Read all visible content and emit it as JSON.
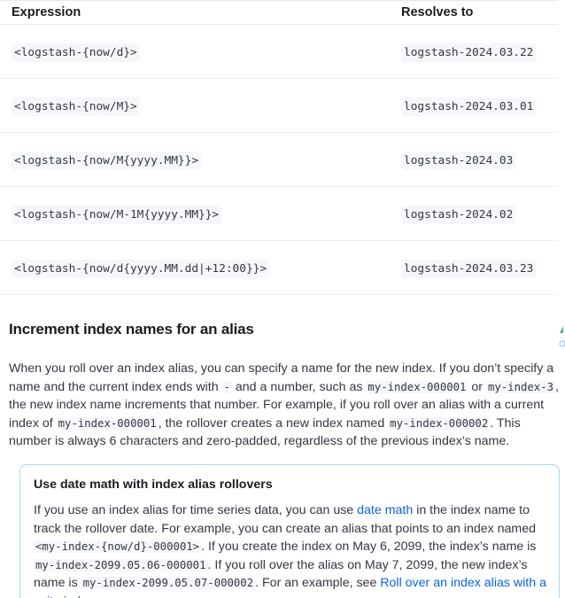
{
  "table": {
    "headers": {
      "expression": "Expression",
      "resolves_to": "Resolves to"
    },
    "rows": [
      {
        "expression": "<logstash-{now/d}>",
        "resolves_to": "logstash-2024.03.22"
      },
      {
        "expression": "<logstash-{now/M}>",
        "resolves_to": "logstash-2024.03.01"
      },
      {
        "expression": "<logstash-{now/M{yyyy.MM}}>",
        "resolves_to": "logstash-2024.03"
      },
      {
        "expression": "<logstash-{now/M-1M{yyyy.MM}}>",
        "resolves_to": "logstash-2024.02"
      },
      {
        "expression": "<logstash-{now/d{yyyy.MM.dd|+12:00}}>",
        "resolves_to": "logstash-2024.03.23"
      }
    ]
  },
  "section": {
    "heading": "Increment index names for an alias",
    "p1": "When you roll over an index alias, you can specify a name for the new index. If you don’t specify a name and the current index ends with ",
    "code_dash": "-",
    "p2": " and a number, such as ",
    "code_ex1": "my-index-000001",
    "p3": " or ",
    "code_ex2": "my-index-3",
    "p4": ", the new index name increments that number. For example, if you roll over an alias with a current index of ",
    "code_ex3": "my-index-000001",
    "p5": ", the rollover creates a new index named ",
    "code_ex4": "my-index-000002",
    "p6": ". This number is always 6 characters and zero-padded, regardless of the previous index’s name."
  },
  "callout": {
    "title": "Use date math with index alias rollovers",
    "t1": "If you use an index alias for time series data, you can use ",
    "link1": "date math",
    "t2": " in the index name to track the rollover date. For example, you can create an alias that points to an index named ",
    "code1": "<my-index-{now/d}-000001>",
    "t3": ". If you create the index on May 6, 2099, the index’s name is ",
    "code2": "my-index-2099.05.06-000001",
    "t4": ". If you roll over the alias on May 7, 2099, the new index’s name is ",
    "code3": "my-index-2099.05.07-000002",
    "t5": ". For an example, see ",
    "link2": "Roll over an index alias with a write index",
    "t6": "."
  },
  "colors": {
    "link": "#0b64dd",
    "callout_border": "#a7d7f2",
    "code_bg": "#f5f7fa"
  }
}
